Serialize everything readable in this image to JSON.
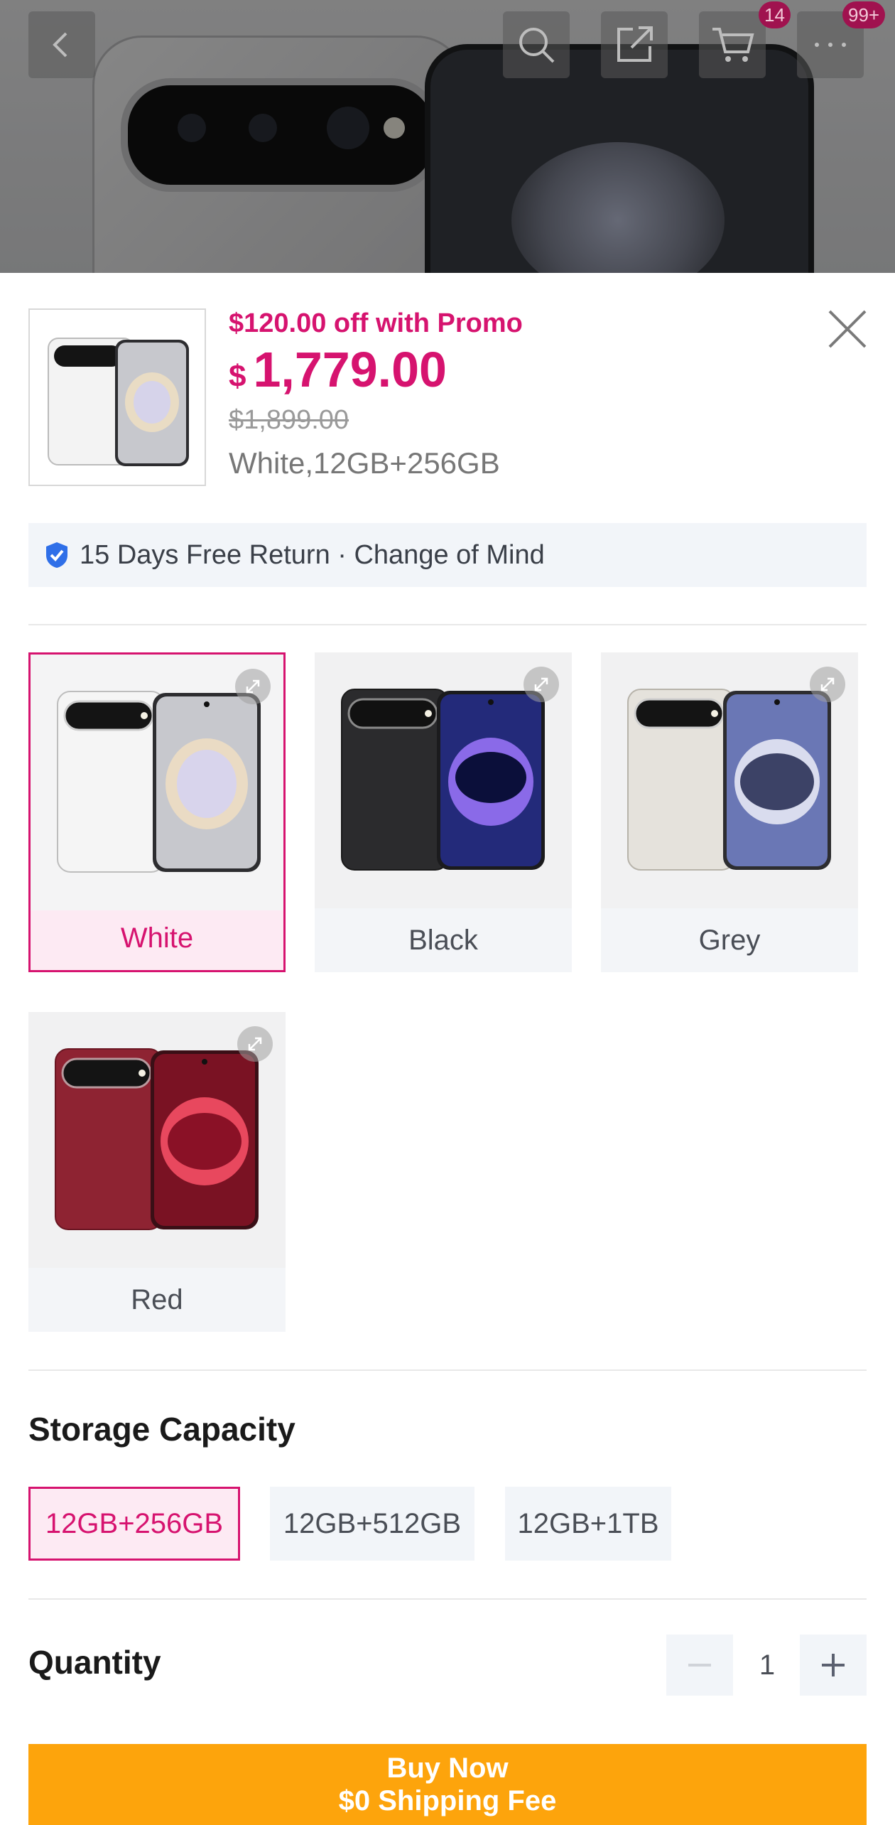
{
  "header": {
    "cart_count": "14",
    "more_count": "99+"
  },
  "product": {
    "promo": "$120.00 off with Promo",
    "currency": "$",
    "price": "1,779.00",
    "original_price": "$1,899.00",
    "selected_variant": "White,12GB+256GB"
  },
  "guarantee": {
    "text": "15 Days Free Return · Change of Mind",
    "icon": "shield-check-icon"
  },
  "colors": [
    {
      "label": "White",
      "selected": true,
      "body": "#f3f3f3",
      "screen": "#c8c8cc"
    },
    {
      "label": "Black",
      "selected": false,
      "body": "#2b2b2d",
      "screen": "#2a2f86"
    },
    {
      "label": "Grey",
      "selected": false,
      "body": "#e3e0da",
      "screen": "#5e6aa6"
    },
    {
      "label": "Red",
      "selected": false,
      "body": "#8e2332",
      "screen": "#7e1627"
    }
  ],
  "storage": {
    "title": "Storage Capacity",
    "options": [
      "12GB+256GB",
      "12GB+512GB",
      "12GB+1TB"
    ],
    "selected": "12GB+256GB"
  },
  "quantity": {
    "title": "Quantity",
    "value": "1"
  },
  "buy_button": {
    "line1": "Buy Now",
    "line2": "$0 Shipping Fee"
  },
  "theme": {
    "accent": "#d6136f",
    "cta": "#fda40c"
  }
}
